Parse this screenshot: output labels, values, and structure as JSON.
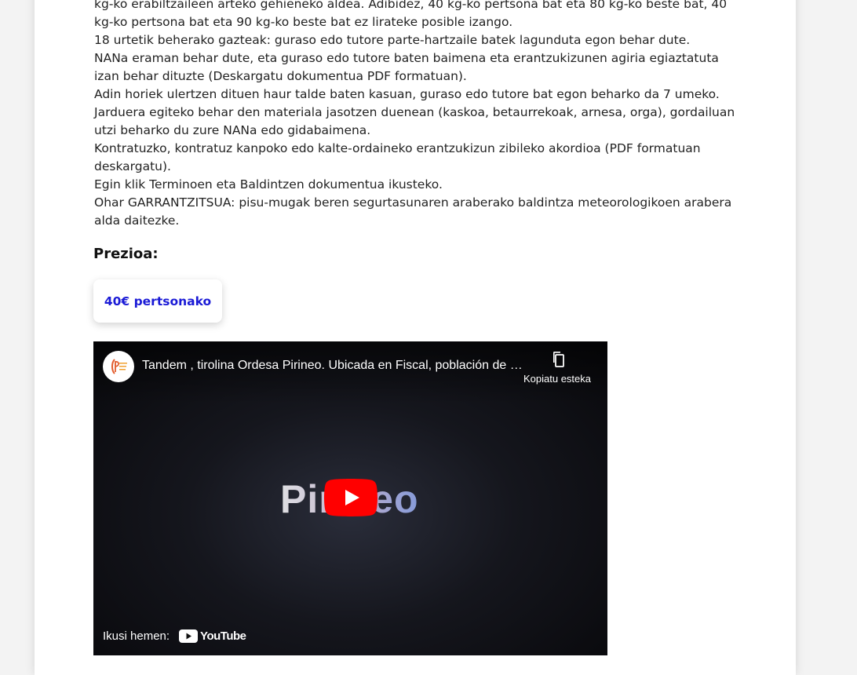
{
  "paragraphs": [
    "kg-ko erabiltzaileen arteko gehieneko aldea. Adibidez, 40 kg-ko pertsona bat eta 80 kg-ko beste bat, 40 kg-ko pertsona bat eta 90 kg-ko beste bat ez lirateke posible izango.",
    "18 urtetik beherako gazteak: guraso edo tutore parte-hartzaile batek lagunduta egon behar dute.",
    "NANa eraman behar dute, eta guraso edo tutore baten baimena eta erantzukizunen agiria egiaztatuta izan behar dituzte (Deskargatu dokumentua PDF formatuan).",
    "Adin horiek ulertzen dituen haur talde baten kasuan, guraso edo tutore bat egon beharko da 7 umeko.",
    "Jarduera egiteko behar den materiala jasotzen duenean (kaskoa, betaurrekoak, arnesa, orga), gordailuan utzi beharko du zure NANa edo gidabaimena.",
    "Kontratuzko, kontratuz kanpoko edo kalte-ordaineko erantzukizun zibileko akordioa (PDF formatuan deskargatu).",
    "Egin klik Terminoen eta Baldintzen dokumentua ikusteko.",
    "Ohar GARRANTZITSUA: pisu-mugak beren segurtasunaren araberako baldintza meteorologikoen arabera alda daitezke."
  ],
  "price": {
    "heading": "Prezioa:",
    "label": "40€ pertsonako"
  },
  "video": {
    "title": "Tandem , tirolina Ordesa Pirineo. Ubicada en Fiscal, población de Sobrarbe",
    "copy_label": "Kopiatu esteka",
    "logo_text": "Pirineo",
    "watch_label": "Ikusi hemen:",
    "youtube_word": "YouTube",
    "avatar_icon": "ordesa-tirolina-logo-icon"
  },
  "colors": {
    "price_text": "#1a1ad6",
    "play_red": "#ff0000",
    "background": "#f3f3f3"
  }
}
